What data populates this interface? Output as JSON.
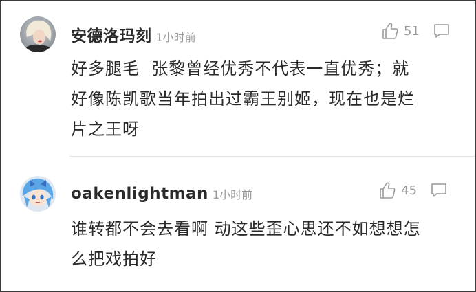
{
  "comments": [
    {
      "username": "安德洛玛刻",
      "timestamp": "1小时前",
      "likes": "51",
      "text": "好多腿毛  张黎曾经优秀不代表一直优秀；就\n好像陈凯歌当年拍出过霸王别姬，现在也是烂\n片之王呀"
    },
    {
      "username": "oakenlightman",
      "timestamp": "1小时前",
      "likes": "45",
      "text": "谁转都不会去看啊 动这些歪心思还不如想想怎\n么把戏拍好"
    }
  ],
  "icons": {
    "like": "thumbs-up-icon",
    "reply": "comment-bubble-icon"
  },
  "colors": {
    "text": "#2a2a2a",
    "muted": "#9a9a9a",
    "divider": "#e4e4e4"
  }
}
